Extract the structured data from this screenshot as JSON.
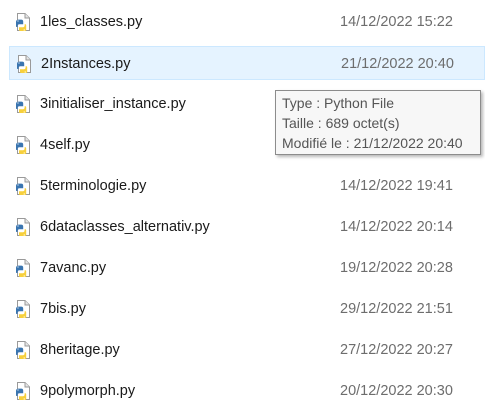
{
  "files": [
    {
      "name": "1les_classes.py",
      "modified": "14/12/2022 15:22",
      "selected": false
    },
    {
      "name": "2Instances.py",
      "modified": "21/12/2022 20:40",
      "selected": true
    },
    {
      "name": "3initialiser_instance.py",
      "modified": "",
      "selected": false
    },
    {
      "name": "4self.py",
      "modified": "",
      "selected": false
    },
    {
      "name": "5terminologie.py",
      "modified": "14/12/2022 19:41",
      "selected": false
    },
    {
      "name": "6dataclasses_alternativ.py",
      "modified": "14/12/2022 20:14",
      "selected": false
    },
    {
      "name": "7avanc.py",
      "modified": "19/12/2022 20:28",
      "selected": false
    },
    {
      "name": "7bis.py",
      "modified": "29/12/2022 21:51",
      "selected": false
    },
    {
      "name": "8heritage.py",
      "modified": "27/12/2022 20:27",
      "selected": false
    },
    {
      "name": "9polymorph.py",
      "modified": "20/12/2022 20:30",
      "selected": false
    }
  ],
  "file_icon": "python-file-icon",
  "tooltip": {
    "type": "Type : Python File",
    "size": "Taille : 689 octet(s)",
    "modified": "Modifié le : 21/12/2022 20:40"
  },
  "colors": {
    "selection_bg": "#e5f3ff",
    "selection_border": "#cce8ff",
    "python_blue": "#3a75b0",
    "python_yellow": "#f7d03c"
  }
}
